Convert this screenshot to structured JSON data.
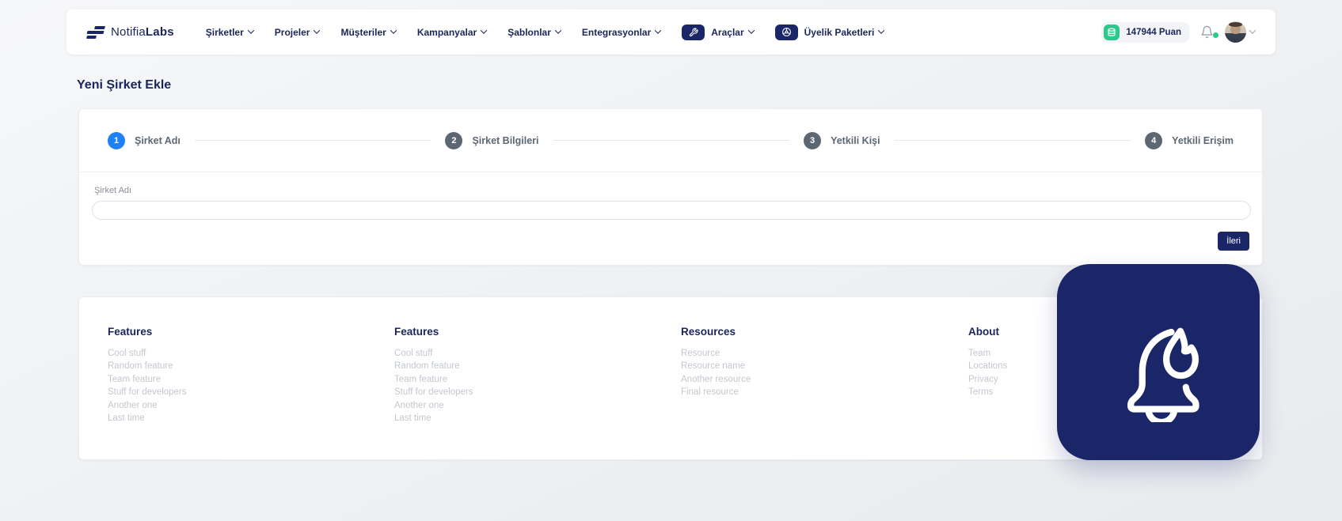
{
  "brand": {
    "name_regular": "Notifia",
    "name_bold": "Labs"
  },
  "nav": {
    "items": [
      {
        "label": "Şirketler"
      },
      {
        "label": "Projeler"
      },
      {
        "label": "Müşteriler"
      },
      {
        "label": "Kampanyalar"
      },
      {
        "label": "Şablonlar"
      },
      {
        "label": "Entegrasyonlar"
      },
      {
        "label": "Araçlar",
        "icon": "wrench-icon"
      },
      {
        "label": "Üyelik Paketleri",
        "icon": "steering-wheel-icon"
      }
    ]
  },
  "header_right": {
    "points": "147944 Puan"
  },
  "page": {
    "title": "Yeni Şirket Ekle"
  },
  "stepper": {
    "steps": [
      {
        "number": "1",
        "label": "Şirket Adı",
        "active": true
      },
      {
        "number": "2",
        "label": "Şirket Bilgileri",
        "active": false
      },
      {
        "number": "3",
        "label": "Yetkili Kişi",
        "active": false
      },
      {
        "number": "4",
        "label": "Yetkili Erişim",
        "active": false
      }
    ]
  },
  "form": {
    "label": "Şirket Adı",
    "value": "",
    "next_button": "İleri"
  },
  "footer": {
    "columns": [
      {
        "heading": "Features",
        "links": [
          "Cool stuff",
          "Random feature",
          "Team feature",
          "Stuff for developers",
          "Another one",
          "Last time"
        ]
      },
      {
        "heading": "Features",
        "links": [
          "Cool stuff",
          "Random feature",
          "Team feature",
          "Stuff for developers",
          "Another one",
          "Last time"
        ]
      },
      {
        "heading": "Resources",
        "links": [
          "Resource",
          "Resource name",
          "Another resource",
          "Final resource"
        ]
      },
      {
        "heading": "About",
        "links": [
          "Team",
          "Locations",
          "Privacy",
          "Terms"
        ]
      }
    ]
  },
  "colors": {
    "navy": "#1b2668",
    "text_navy": "#1b2559",
    "accent_blue": "#2080f6",
    "green": "#2bc98a",
    "muted_gray": "#c3c8cf"
  }
}
